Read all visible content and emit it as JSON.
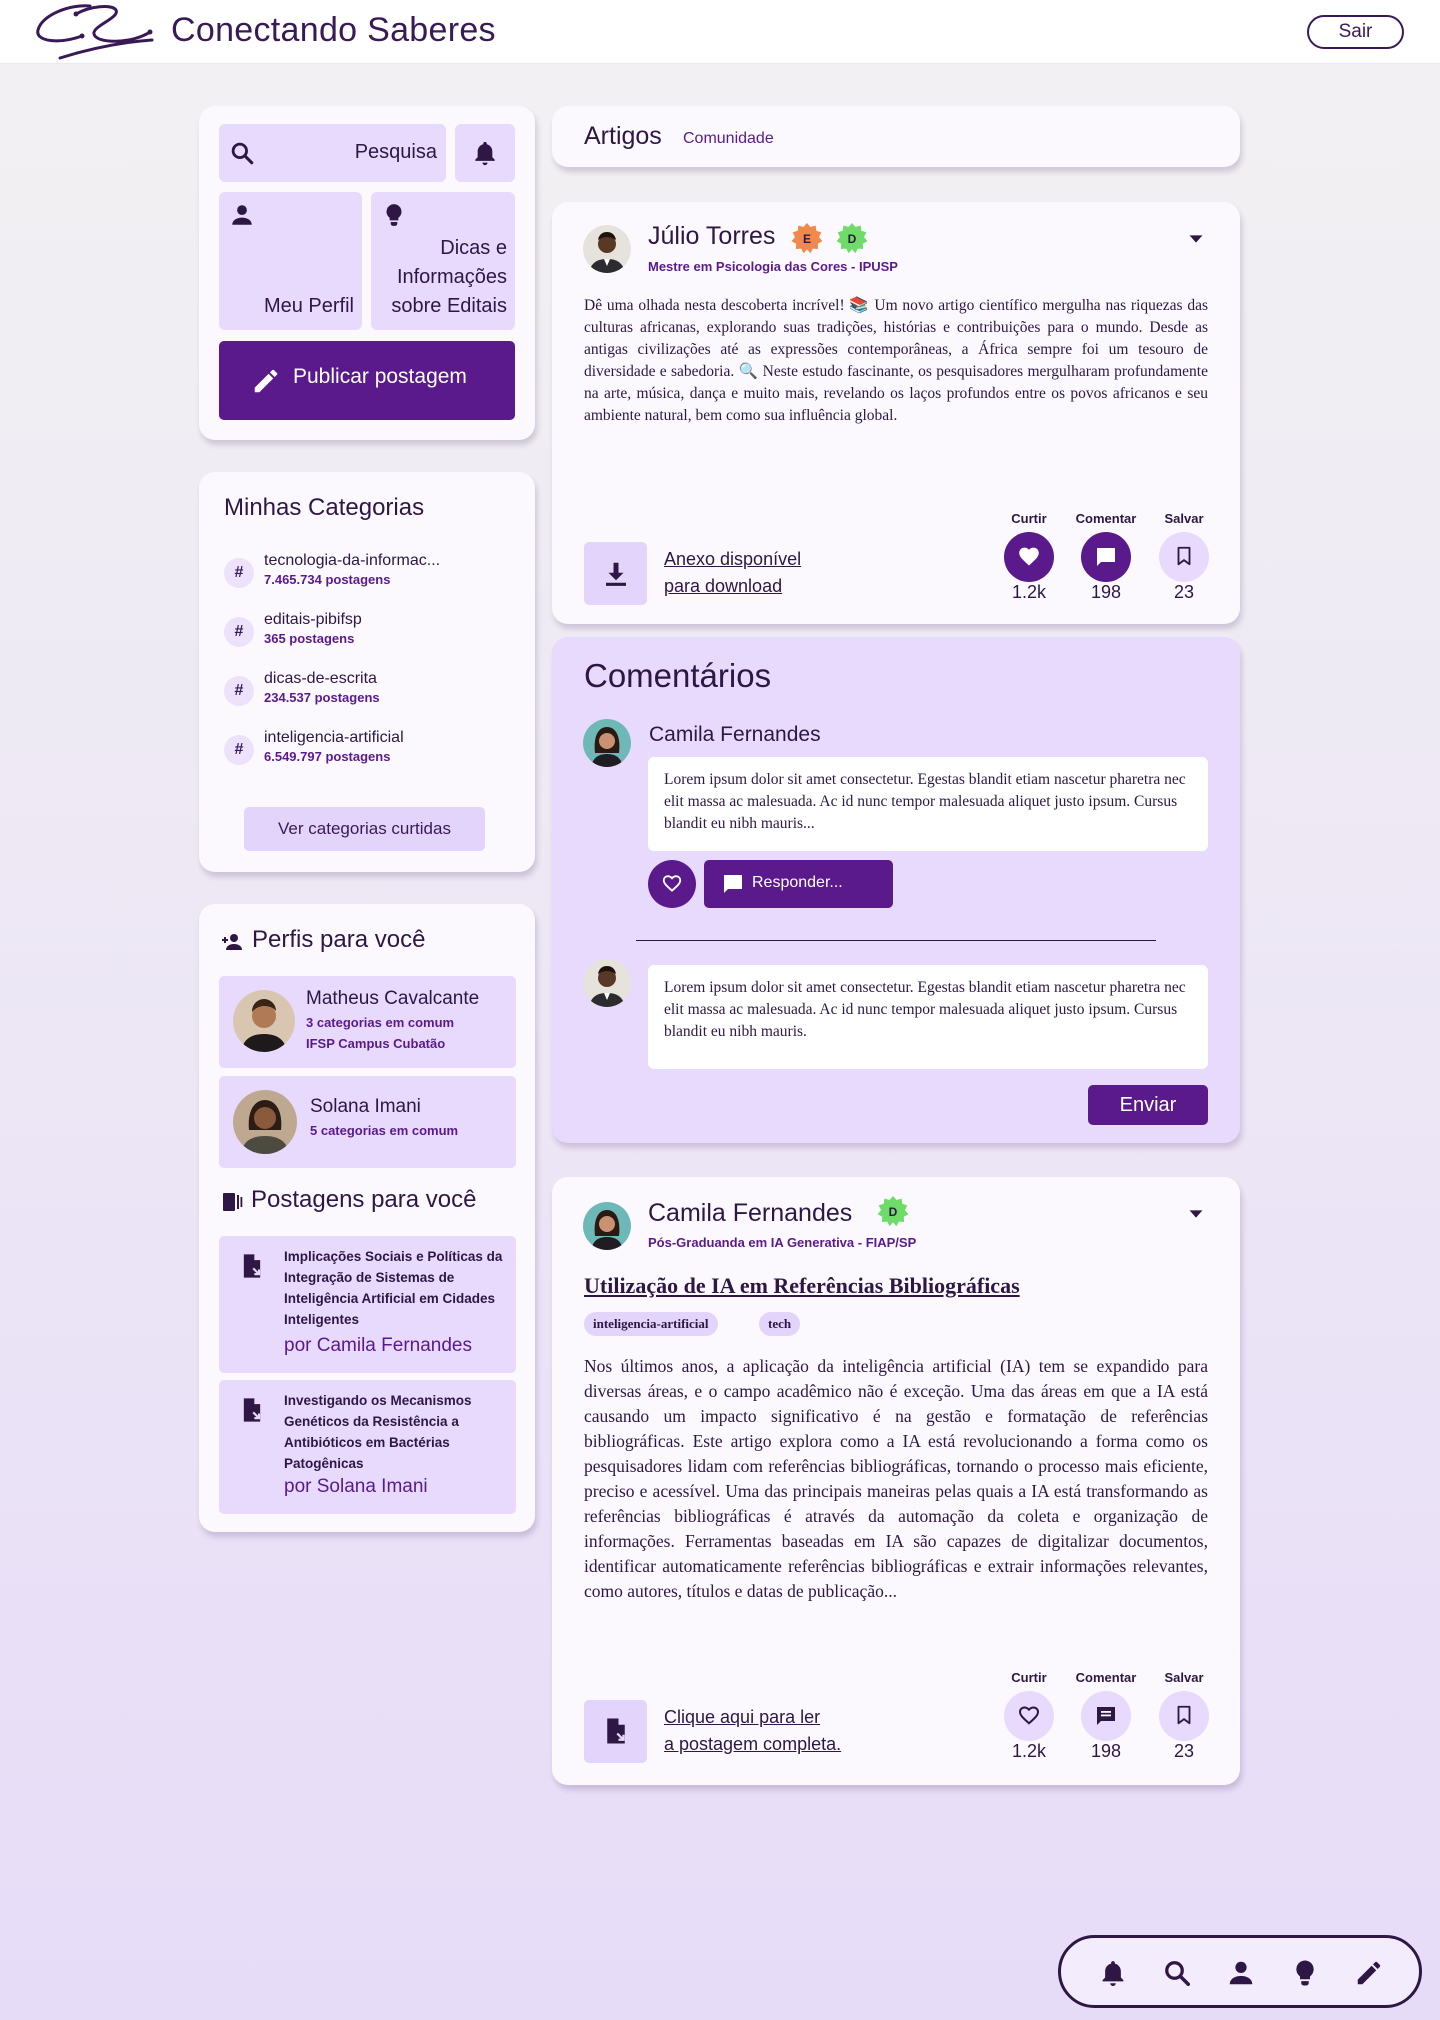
{
  "header": {
    "brand": "Conectando Saberes",
    "logout_label": "Sair"
  },
  "sidebar": {
    "search_label": "Pesquisa",
    "profile_label": "Meu Perfil",
    "tips_label_lines": [
      "Dicas e",
      "Informações",
      "sobre Editais"
    ],
    "publish_label": "Publicar postagem"
  },
  "categories": {
    "title": "Minhas Categorias",
    "items": [
      {
        "name": "tecnologia-da-informac...",
        "count": "7.465.734 postagens"
      },
      {
        "name": "editais-pibifsp",
        "count": "365 postagens"
      },
      {
        "name": "dicas-de-escrita",
        "count": "234.537 postagens"
      },
      {
        "name": "inteligencia-artificial",
        "count": "6.549.797 postagens"
      }
    ],
    "button_label": "Ver categorias curtidas"
  },
  "profiles": {
    "title": "Perfis para você",
    "items": [
      {
        "name": "Matheus Cavalcante",
        "line1": "3 categorias em comum",
        "line2": "IFSP Campus Cubatão"
      },
      {
        "name": "Solana Imani",
        "line1": "5 categorias em comum"
      }
    ]
  },
  "suggested_posts": {
    "title": "Postagens para você",
    "items": [
      {
        "title": "Implicações Sociais e Políticas da Integração de Sistemas de Inteligência Artificial em Cidades Inteligentes",
        "author": "por Camila Fernandes"
      },
      {
        "title": "Investigando os Mecanismos Genéticos da Resistência a Antibióticos em Bactérias Patogênicas",
        "author": "por Solana Imani"
      }
    ]
  },
  "feed_tabs": {
    "active": "Artigos",
    "other": "Comunidade"
  },
  "post1": {
    "author": "Júlio Torres",
    "badges": [
      "E",
      "D"
    ],
    "role": "Mestre em Psicologia das Cores - IPUSP",
    "text": "Dê uma olhada nesta descoberta incrível! 📚 Um novo artigo científico mergulha nas riquezas das culturas africanas, explorando suas tradições, histórias e contribuições para o mundo. Desde as antigas civilizações até as expressões contemporâneas, a África sempre foi um tesouro de diversidade e sabedoria. 🔍 Neste estudo fascinante, os pesquisadores mergulharam profundamente na arte, música, dança e muito mais, revelando os laços profundos entre os povos africanos e seu ambiente natural, bem como sua influência global.",
    "attachment_lines": [
      "Anexo disponível",
      "para download"
    ],
    "actions": {
      "like_label": "Curtir",
      "comment_label": "Comentar",
      "save_label": "Salvar",
      "likes": "1.2k",
      "comments": "198",
      "saves": "23"
    }
  },
  "comments": {
    "title": "Comentários",
    "items": [
      {
        "author": "Camila Fernandes",
        "text": "Lorem ipsum dolor sit amet consectetur. Egestas blandit etiam nascetur pharetra nec elit massa ac malesuada. Ac id nunc tempor malesuada aliquet justo ipsum. Cursus blandit eu nibh mauris..."
      }
    ],
    "reply_label": "Responder...",
    "draft_text": "Lorem ipsum dolor sit amet consectetur. Egestas blandit etiam nascetur pharetra nec elit massa ac malesuada. Ac id nunc tempor malesuada aliquet justo ipsum. Cursus blandit eu nibh mauris.",
    "send_label": "Enviar"
  },
  "post2": {
    "author": "Camila Fernandes",
    "badges": [
      "D"
    ],
    "role": "Pós-Graduanda em IA Generativa - FIAP/SP",
    "title": "Utilização de IA em Referências Bibliográficas",
    "tags": [
      "inteligencia-artificial",
      "tech"
    ],
    "text": "Nos últimos anos, a aplicação da inteligência artificial (IA) tem se expandido para diversas áreas, e o campo acadêmico não é exceção. Uma das áreas em que a IA está causando um impacto significativo é na gestão e formatação de referências bibliográficas. Este artigo explora como a IA está revolucionando a forma como os pesquisadores lidam com referências bibliográficas, tornando o processo mais eficiente, preciso e acessível. Uma das principais maneiras pelas quais a IA está transformando as referências bibliográficas é através da automação da coleta e organização de informações. Ferramentas baseadas em IA são capazes de digitalizar documentos, identificar automaticamente referências bibliográficas e extrair informações relevantes, como autores, títulos e datas de publicação...",
    "read_more_lines": [
      "Clique aqui para ler",
      "a postagem completa."
    ],
    "actions": {
      "like_label": "Curtir",
      "comment_label": "Comentar",
      "save_label": "Salvar",
      "likes": "1.2k",
      "comments": "198",
      "saves": "23"
    }
  },
  "colors": {
    "primary": "#5a1a8c",
    "tile": "#e7dafd",
    "text": "#2e1744",
    "badge_orange": "#f0894a",
    "badge_green": "#6fdc6a"
  },
  "dock_icons": [
    "bell-icon",
    "search-icon",
    "person-icon",
    "lightbulb-icon",
    "pencil-icon"
  ]
}
